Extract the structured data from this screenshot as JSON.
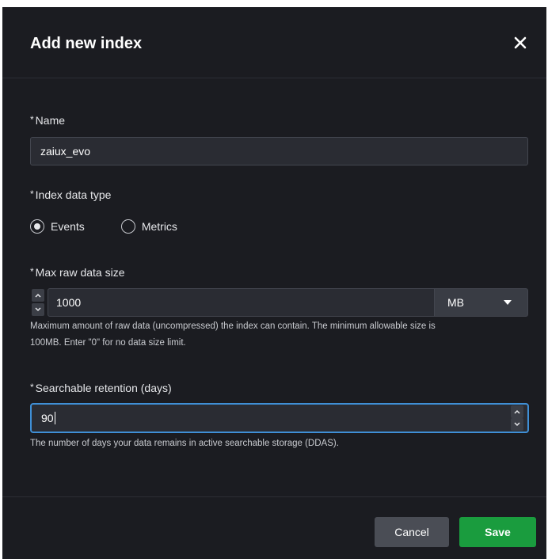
{
  "dialog": {
    "title": "Add new index",
    "close_icon": "close-icon"
  },
  "form": {
    "required_marker": "*",
    "name": {
      "label": "Name",
      "value": "zaiux_evo"
    },
    "data_type": {
      "label": "Index data type",
      "options": [
        {
          "label": "Events",
          "selected": true
        },
        {
          "label": "Metrics",
          "selected": false
        }
      ]
    },
    "max_size": {
      "label": "Max raw data size",
      "value": "1000",
      "unit": "MB",
      "help_line1": "Maximum amount of raw data (uncompressed) the index can contain. The minimum allowable size is",
      "help_line2": "100MB. Enter \"0\" for no data size limit."
    },
    "retention": {
      "label": "Searchable retention (days)",
      "value": "90",
      "help": "The number of days your data remains in active searchable storage (DDAS)."
    }
  },
  "footer": {
    "cancel_label": "Cancel",
    "save_label": "Save"
  },
  "colors": {
    "background": "#1b1c21",
    "input_bg": "#2a2c33",
    "focus_border": "#3f8fd6",
    "save_button": "#1a9c3e",
    "cancel_button": "#4a4d55"
  }
}
